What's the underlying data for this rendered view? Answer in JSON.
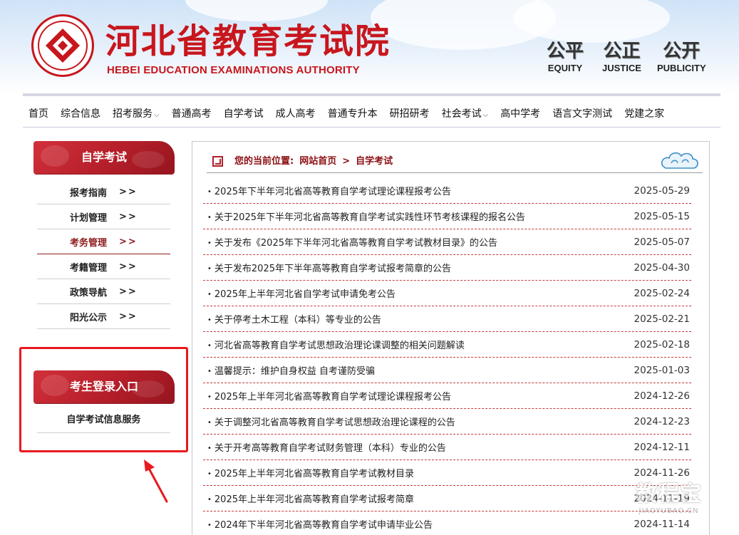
{
  "header": {
    "title": "河北省教育考试院",
    "subtitle": "HEBEI EDUCATION EXAMINATIONS AUTHORITY",
    "mottos": [
      {
        "cn": "公平",
        "en": "EQUITY"
      },
      {
        "cn": "公正",
        "en": "JUSTICE"
      },
      {
        "cn": "公开",
        "en": "PUBLICITY"
      }
    ]
  },
  "nav": {
    "items": [
      {
        "label": "首页",
        "dropdown": false
      },
      {
        "label": "综合信息",
        "dropdown": false
      },
      {
        "label": "招考服务",
        "dropdown": true
      },
      {
        "label": "普通高考",
        "dropdown": false
      },
      {
        "label": "自学考试",
        "dropdown": false
      },
      {
        "label": "成人高考",
        "dropdown": false
      },
      {
        "label": "普通专升本",
        "dropdown": false
      },
      {
        "label": "研招研考",
        "dropdown": false
      },
      {
        "label": "社会考试",
        "dropdown": true
      },
      {
        "label": "高中学考",
        "dropdown": false
      },
      {
        "label": "语言文字测试",
        "dropdown": false
      },
      {
        "label": "党建之家",
        "dropdown": false
      }
    ],
    "chevron": "⌵"
  },
  "sidebar": {
    "section_title": "自学考试",
    "arrow": ">>",
    "items": [
      {
        "label": "报考指南",
        "active": false
      },
      {
        "label": "计划管理",
        "active": false
      },
      {
        "label": "考务管理",
        "active": true
      },
      {
        "label": "考籍管理",
        "active": false
      },
      {
        "label": "政策导航",
        "active": false
      },
      {
        "label": "阳光公示",
        "active": false
      }
    ],
    "login_title": "考生登录入口",
    "login_link": "自学考试信息服务"
  },
  "breadcrumb": {
    "label": "您的当前位置:",
    "home": "网站首页",
    "separator": ">",
    "current": "自学考试"
  },
  "news": [
    {
      "title": "2025年下半年河北省高等教育自学考试理论课程报考公告",
      "date": "2025-05-29"
    },
    {
      "title": "关于2025年下半年河北省高等教育自学考试实践性环节考核课程的报名公告",
      "date": "2025-05-15"
    },
    {
      "title": "关于发布《2025年下半年河北省高等教育自学考试教材目录》的公告",
      "date": "2025-05-07"
    },
    {
      "title": "关于发布2025年下半年高等教育自学考试报考简章的公告",
      "date": "2025-04-30"
    },
    {
      "title": "2025年上半年河北省自学考试申请免考公告",
      "date": "2025-02-24"
    },
    {
      "title": "关于停考土木工程（本科）等专业的公告",
      "date": "2025-02-21"
    },
    {
      "title": "河北省高等教育自学考试思想政治理论课调整的相关问题解读",
      "date": "2025-02-18"
    },
    {
      "title": "温馨提示：维护自身权益 自考谨防受骗",
      "date": "2025-01-03"
    },
    {
      "title": "2025年上半年河北省高等教育自学考试理论课程报考公告",
      "date": "2024-12-26"
    },
    {
      "title": "关于调整河北省高等教育自学考试思想政治理论课程的公告",
      "date": "2024-12-23"
    },
    {
      "title": "关于开考高等教育自学考试财务管理（本科）专业的公告",
      "date": "2024-12-11"
    },
    {
      "title": "2025年上半年河北省高等教育自学考试教材目录",
      "date": "2024-11-26"
    },
    {
      "title": "2025年上半年河北省高等教育自学考试报考简章",
      "date": "2024-11-19"
    },
    {
      "title": "2024年下半年河北省高等教育自学考试申请毕业公告",
      "date": "2024-11-14"
    }
  ],
  "watermark": {
    "big": "教程宝",
    "small": "JIAOYUBAO.CN"
  },
  "colors": {
    "brand_red": "#c8161d",
    "highlight_border": "#e8191f",
    "dark_red": "#8c1014"
  }
}
